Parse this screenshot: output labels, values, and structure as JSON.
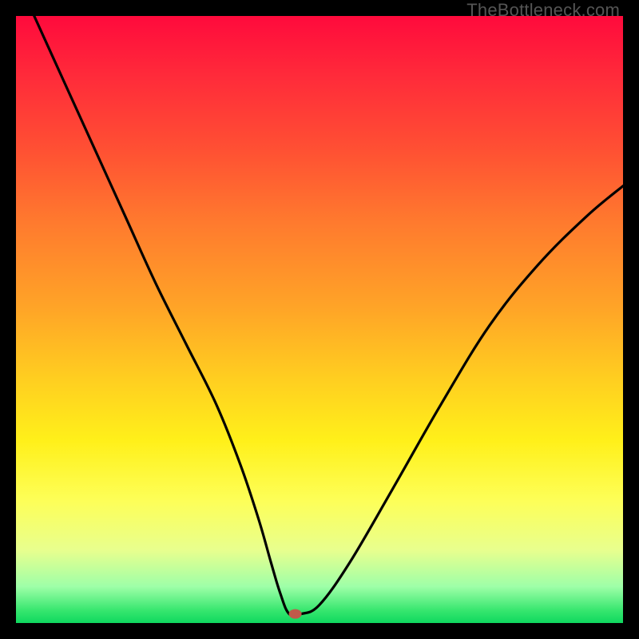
{
  "watermark": "TheBottleneck.com",
  "chart_data": {
    "type": "line",
    "title": "",
    "xlabel": "",
    "ylabel": "",
    "xlim": [
      0,
      100
    ],
    "ylim": [
      0,
      100
    ],
    "grid": false,
    "series": [
      {
        "name": "bottleneck-curve",
        "x": [
          3,
          8,
          13,
          18,
          23,
          28,
          33,
          37,
          40,
          42,
          43.5,
          45,
          47,
          50,
          55,
          62,
          70,
          78,
          86,
          94,
          100
        ],
        "y": [
          100,
          89,
          78,
          67,
          56,
          46,
          36,
          26,
          17,
          10,
          5,
          1.5,
          1.5,
          3,
          10,
          22,
          36,
          49,
          59,
          67,
          72
        ]
      }
    ],
    "marker": {
      "name": "optimal-point",
      "x": 46,
      "y": 1.5,
      "color": "#c05a4a"
    },
    "colors": {
      "curve": "#000000",
      "background_top": "#ff0a3c",
      "background_bottom": "#0fd85f"
    }
  }
}
